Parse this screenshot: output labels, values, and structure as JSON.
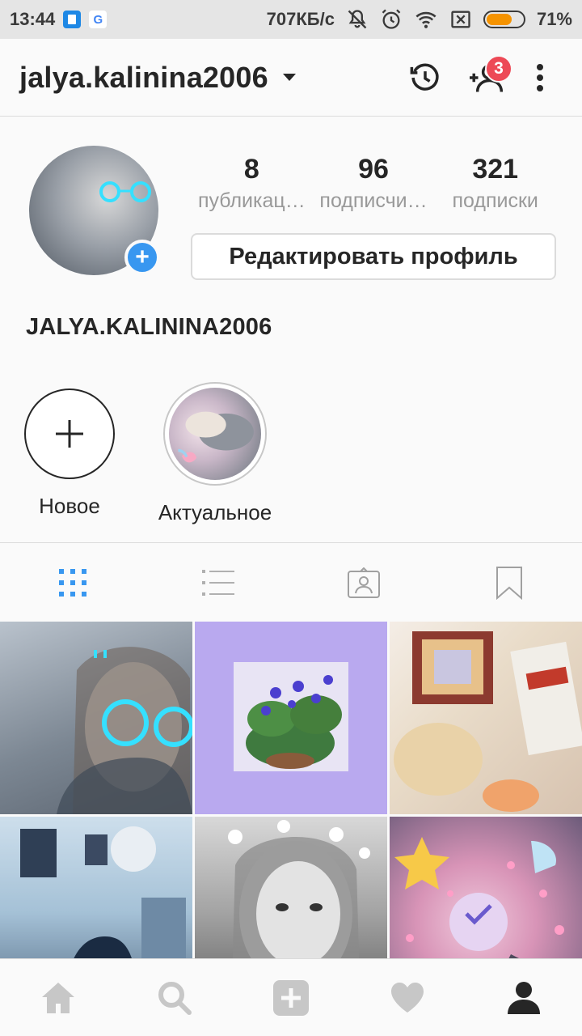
{
  "status_bar": {
    "time": "13:44",
    "speed": "707КБ/с",
    "battery": "71%",
    "battery_level": 0.71
  },
  "app_bar": {
    "username": "jalya.kalinina2006",
    "badge_count": "3"
  },
  "profile": {
    "stats": [
      {
        "value": "8",
        "label": "публикац…"
      },
      {
        "value": "96",
        "label": "подписчи…"
      },
      {
        "value": "321",
        "label": "подписки"
      }
    ],
    "edit_button": "Редактировать профиль",
    "display_name": "JALYA.KALININA2006"
  },
  "highlights": [
    {
      "label": "Новое"
    },
    {
      "label": "Актуальное"
    }
  ],
  "tabs": [
    "grid-icon",
    "list-icon",
    "tagged-icon",
    "saved-icon"
  ],
  "colors": {
    "accent": "#3897f0",
    "badge": "#ed4956",
    "active_tab": "#3897f0",
    "inactive": "#c7c7c7"
  },
  "bottom_nav": [
    "home-icon",
    "search-icon",
    "add-icon",
    "heart-icon",
    "profile-icon"
  ]
}
